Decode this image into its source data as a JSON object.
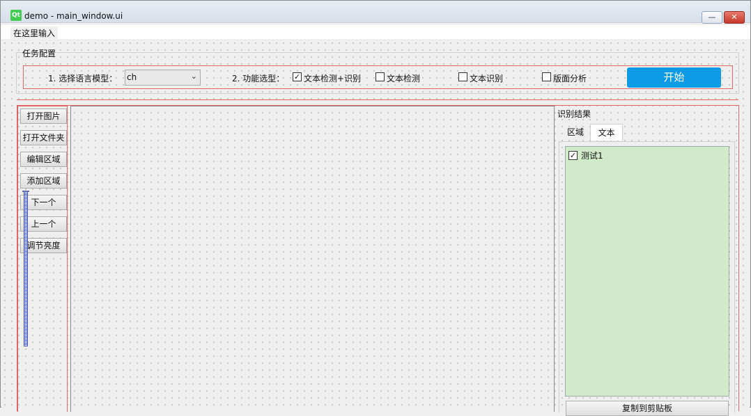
{
  "window": {
    "title": "demo - main_window.ui",
    "logo_text": "Qt",
    "minimize_glyph": "—",
    "close_glyph": "✕"
  },
  "menubar": {
    "placeholder_item": "在这里输入"
  },
  "task_config": {
    "group_title": "任务配置",
    "model_label": "1. 选择语言模型：",
    "model_value": "ch",
    "function_label": "2. 功能选型：",
    "options": [
      {
        "label": "文本检测+识别",
        "checked": true
      },
      {
        "label": "文本检测",
        "checked": false
      },
      {
        "label": "文本识别",
        "checked": false
      },
      {
        "label": "版面分析",
        "checked": false
      }
    ],
    "start_label": "开始"
  },
  "sidebar": {
    "buttons": [
      "打开图片",
      "打开文件夹",
      "编辑区域",
      "添加区域",
      "下一个",
      "上一个",
      "调节亮度"
    ]
  },
  "results": {
    "title": "识别结果",
    "tabs": [
      {
        "label": "区域",
        "active": false
      },
      {
        "label": "文本",
        "active": true
      }
    ],
    "items": [
      {
        "label": "测试1",
        "checked": true
      }
    ],
    "copy_label": "复制到剪贴板"
  },
  "colors": {
    "accent": "#0c9be4",
    "list_bg": "#d1ebca",
    "layout_border": "#e06666"
  }
}
